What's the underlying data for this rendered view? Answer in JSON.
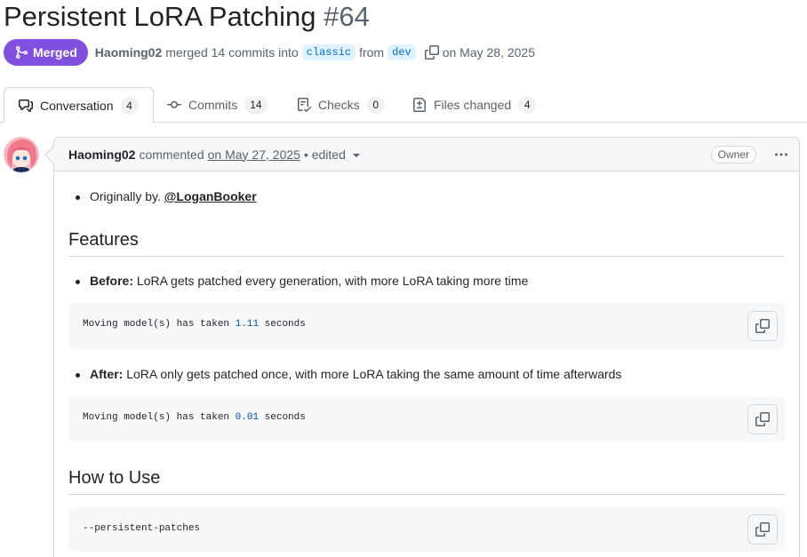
{
  "pr": {
    "title": "Persistent LoRA Patching",
    "number": "#64",
    "status": "Merged",
    "author": "Haoming02",
    "merge_text": "merged 14 commits into",
    "base_branch": "classic",
    "from_text": "from",
    "head_branch": "dev",
    "date_text": "on May 28, 2025",
    "status_color": "#8250df"
  },
  "tabs": [
    {
      "label": "Conversation",
      "count": "4",
      "icon": "comment-discussion-icon"
    },
    {
      "label": "Commits",
      "count": "14",
      "icon": "git-commit-icon"
    },
    {
      "label": "Checks",
      "count": "0",
      "icon": "checklist-icon"
    },
    {
      "label": "Files changed",
      "count": "4",
      "icon": "file-diff-icon"
    }
  ],
  "comment": {
    "author": "Haoming02",
    "action": "commented",
    "date": "on May 27, 2025",
    "edited": "• edited",
    "role_badge": "Owner",
    "credit_prefix": "Originally by.",
    "credit_mention": "@LoganBooker",
    "features_heading": "Features",
    "before_label": "Before:",
    "before_text": "LoRA gets patched every generation, with more LoRA taking more time",
    "before_code_prefix": "Moving model(s) has taken ",
    "before_code_value": "1.11",
    "before_code_suffix": " seconds",
    "after_label": "After:",
    "after_text": "LoRA only gets patched once, with more LoRA taking the same amount of time afterwards",
    "after_code_prefix": "Moving model(s) has taken ",
    "after_code_value": "0.01",
    "after_code_suffix": " seconds",
    "usage_heading": "How to Use",
    "usage_code": "--persistent-patches"
  }
}
